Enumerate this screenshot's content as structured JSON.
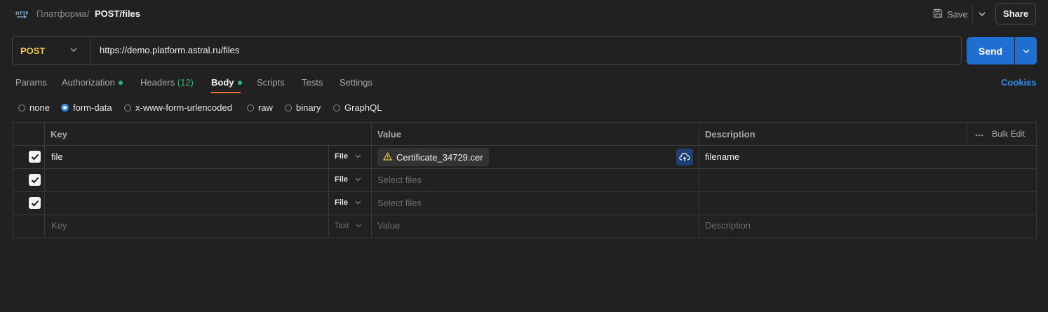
{
  "header": {
    "protocol_icon": "http-icon",
    "breadcrumb_parent": "Платформа",
    "breadcrumb_separator": "/",
    "breadcrumb_current": "POST/files",
    "save_label": "Save",
    "share_label": "Share"
  },
  "request": {
    "method": "POST",
    "url": "https://demo.platform.astral.ru/files",
    "send_label": "Send"
  },
  "tabs": [
    {
      "label": "Params"
    },
    {
      "label": "Authorization"
    },
    {
      "label": "Headers",
      "count": "(12)"
    },
    {
      "label": "Body"
    },
    {
      "label": "Scripts"
    },
    {
      "label": "Tests"
    },
    {
      "label": "Settings"
    }
  ],
  "cookies_label": "Cookies",
  "body_types": [
    "none",
    "form-data",
    "x-www-form-urlencoded",
    "raw",
    "binary",
    "GraphQL"
  ],
  "body_type_selected": "form-data",
  "table": {
    "headers": {
      "key": "Key",
      "value": "Value",
      "description": "Description"
    },
    "bulk_edit_label": "Bulk Edit",
    "rows": [
      {
        "checked": true,
        "key": "file",
        "type": "File",
        "value_file": "Certificate_34729.cer",
        "description": "filename"
      },
      {
        "checked": true,
        "key": "",
        "type": "File",
        "value_placeholder": "Select files",
        "description": ""
      },
      {
        "checked": true,
        "key": "",
        "type": "File",
        "value_placeholder": "Select files",
        "description": ""
      }
    ],
    "new_row": {
      "key_placeholder": "Key",
      "type": "Text",
      "value_placeholder": "Value",
      "description_placeholder": "Description"
    }
  },
  "colors": {
    "accent": "#1f6fd1",
    "method": "#f2c94c",
    "active_tab": "#ff6c37",
    "status_dot": "#2eb872",
    "link": "#2f8ce9"
  }
}
